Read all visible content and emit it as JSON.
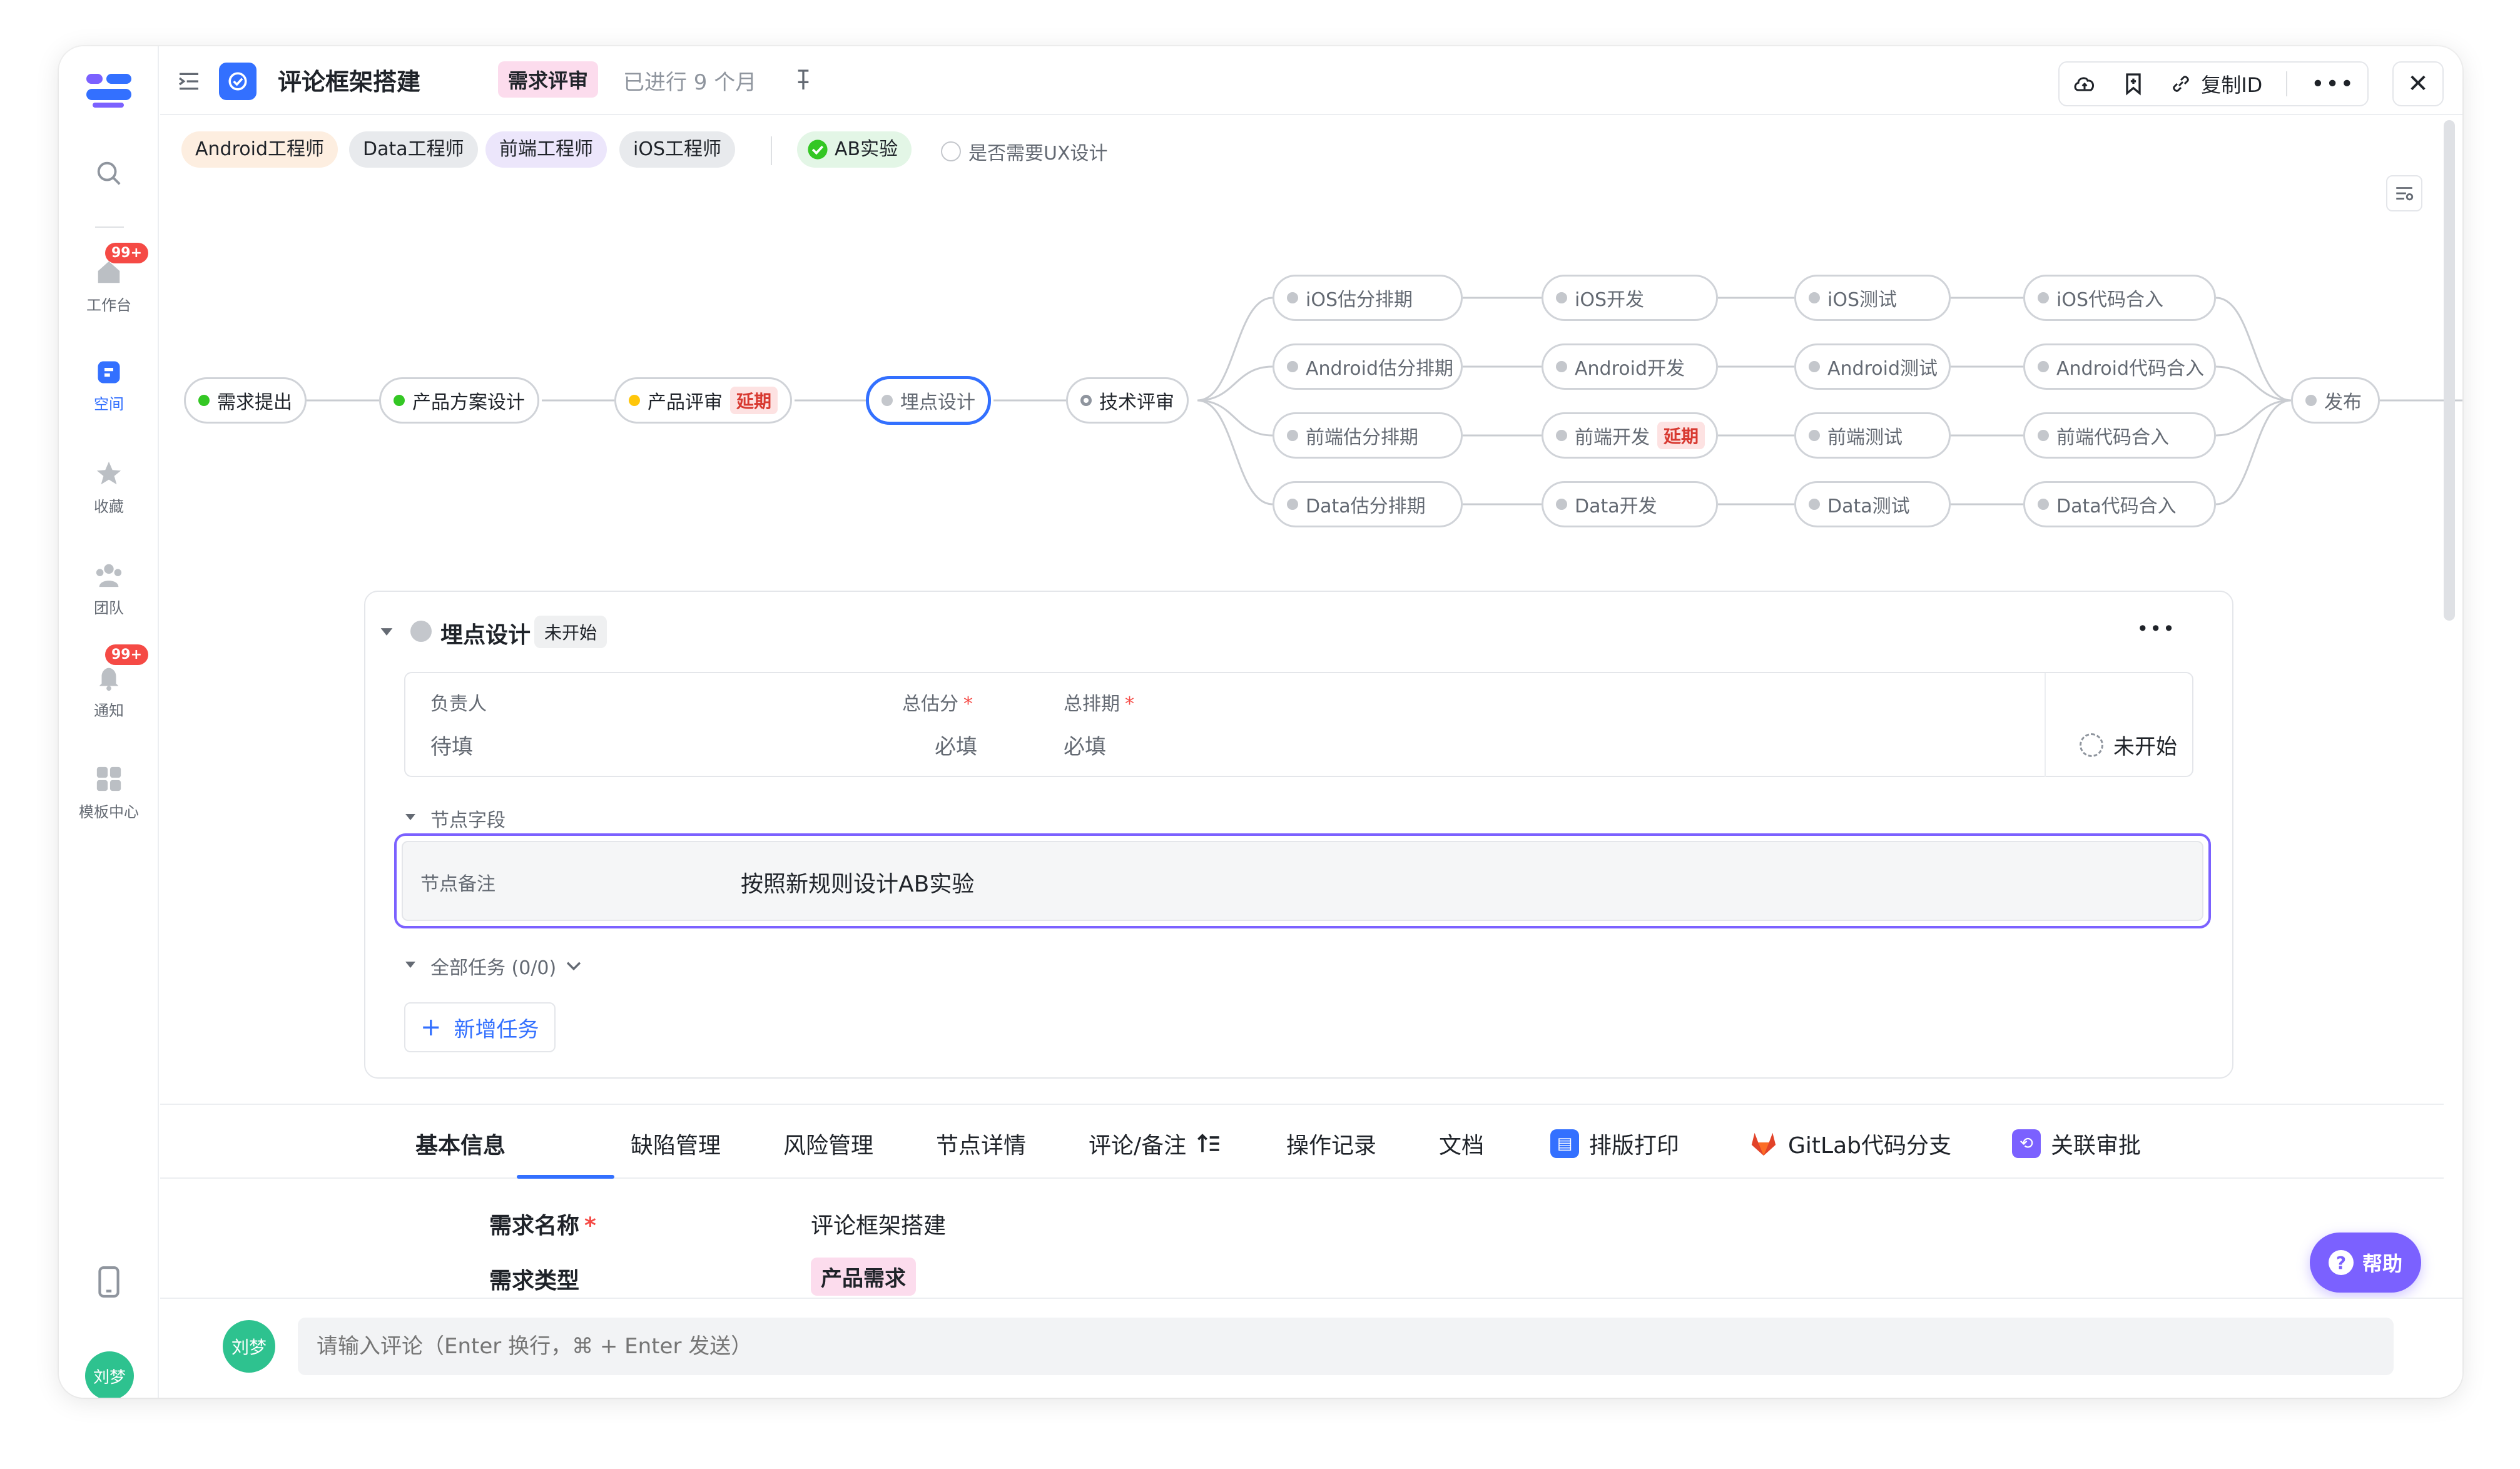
{
  "rail": {
    "items": [
      {
        "label": "",
        "icon": "search-icon"
      },
      {
        "label": "工作台",
        "icon": "home-icon",
        "badge": "99+"
      },
      {
        "label": "空间",
        "icon": "space-icon"
      },
      {
        "label": "收藏",
        "icon": "star-icon"
      },
      {
        "label": "团队",
        "icon": "team-icon"
      },
      {
        "label": "通知",
        "icon": "bell-icon",
        "badge": "99+"
      },
      {
        "label": "模板中心",
        "icon": "template-icon"
      }
    ],
    "avatar": "刘梦"
  },
  "header": {
    "title": "评论框架搭建",
    "status": "需求评审",
    "elapsed": "已进行 9 个月",
    "copy_id": "复制ID"
  },
  "tags": [
    "Android工程师",
    "Data工程师",
    "前端工程师",
    "iOS工程师"
  ],
  "ab_test": "AB实验",
  "ux_option": "是否需要UX设计",
  "flow": {
    "main": [
      {
        "label": "需求提出",
        "state": "done"
      },
      {
        "label": "产品方案设计",
        "state": "done"
      },
      {
        "label": "产品评审",
        "state": "warn",
        "badge": "延期"
      },
      {
        "label": "埋点设计",
        "state": "current"
      },
      {
        "label": "技术评审",
        "state": "pending"
      }
    ],
    "lanes": [
      [
        "iOS估分排期",
        "iOS开发",
        "iOS测试",
        "iOS代码合入"
      ],
      [
        "Android估分排期",
        "Android开发",
        "Android测试",
        "Android代码合入"
      ],
      [
        "前端估分排期",
        "前端开发",
        "前端测试",
        "前端代码合入"
      ],
      [
        "Data估分排期",
        "Data开发",
        "Data测试",
        "Data代码合入"
      ]
    ],
    "lane_badge": "延期",
    "release": "发布"
  },
  "node_detail": {
    "title": "埋点设计",
    "status": "未开始",
    "owner_label": "负责人",
    "owner_value": "待填",
    "estimate_label": "总估分",
    "estimate_value": "必填",
    "schedule_label": "总排期",
    "schedule_value": "必填",
    "progress_status": "未开始",
    "fields_section": "节点字段",
    "note_label": "节点备注",
    "note_value": "按照新规则设计AB实验",
    "tasks_section": "全部任务 (0/0)",
    "add_task": "新增任务"
  },
  "tabs": [
    {
      "label": "基本信息",
      "active": true
    },
    {
      "label": "缺陷管理"
    },
    {
      "label": "风险管理"
    },
    {
      "label": "节点详情"
    },
    {
      "label": "评论/备注"
    },
    {
      "label": "操作记录"
    },
    {
      "label": "文档"
    },
    {
      "label": "排版打印",
      "icon": "print-icon",
      "color": "#3370ff"
    },
    {
      "label": "GitLab代码分支",
      "icon": "gitlab-icon",
      "color": "#e24329"
    },
    {
      "label": "关联审批",
      "icon": "approval-icon",
      "color": "#7b61ff"
    }
  ],
  "basic_info": {
    "name_label": "需求名称",
    "name_value": "评论框架搭建",
    "type_label": "需求类型",
    "type_value": "产品需求"
  },
  "comment": {
    "placeholder": "请输入评论（Enter 换行，⌘ + Enter 发送）",
    "avatar": "刘梦"
  },
  "help": "帮助",
  "colors": {
    "accent": "#3370ff",
    "done": "#34c724",
    "warn": "#ffc60a",
    "danger": "#f54a45",
    "purple": "#7b61ff"
  }
}
